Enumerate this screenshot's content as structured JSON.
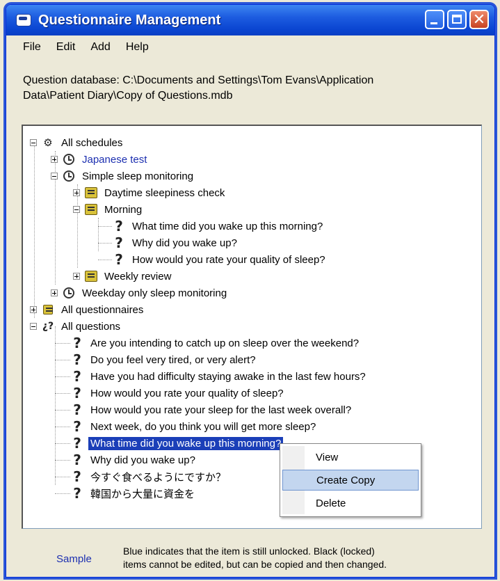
{
  "window": {
    "title": "Questionnaire Management"
  },
  "menu": [
    "File",
    "Edit",
    "Add",
    "Help"
  ],
  "db": {
    "line1": "Question database: C:\\Documents and Settings\\Tom Evans\\Application",
    "line2": "Data\\Patient Diary\\Copy of Questions.mdb"
  },
  "tree": {
    "all_schedules": "All schedules",
    "japanese_test": "Japanese test",
    "simple_sleep": "Simple sleep monitoring",
    "daytime": "Daytime sleepiness check",
    "morning": "Morning",
    "morning_q": [
      "What time did you wake up this morning?",
      "Why did you wake up?",
      "How would you rate your quality of sleep?"
    ],
    "weekly_review": "Weekly review",
    "weekday_only": "Weekday only sleep monitoring",
    "all_questionnaires": "All questionnaires",
    "all_questions": "All questions",
    "questions": [
      "Are you intending to catch up on sleep over the weekend?",
      "Do you feel very tired, or very alert?",
      "Have you had difficulty staying awake in the last few hours?",
      "How would you rate your quality of sleep?",
      "How would you rate your sleep for the last week overall?",
      "Next week, do you think you will get more sleep?",
      "What time did you wake up this morning?",
      "Why did you wake up?",
      "今すぐ食べるようにですか？",
      "韓国から大量に資金を"
    ]
  },
  "context_menu": [
    "View",
    "Create Copy",
    "Delete"
  ],
  "footer": {
    "sample": "Sample",
    "legend_line1": "Blue indicates that the item is still unlocked.  Black (locked)",
    "legend_line2": "items cannot be edited, but can be copied and then changed."
  }
}
